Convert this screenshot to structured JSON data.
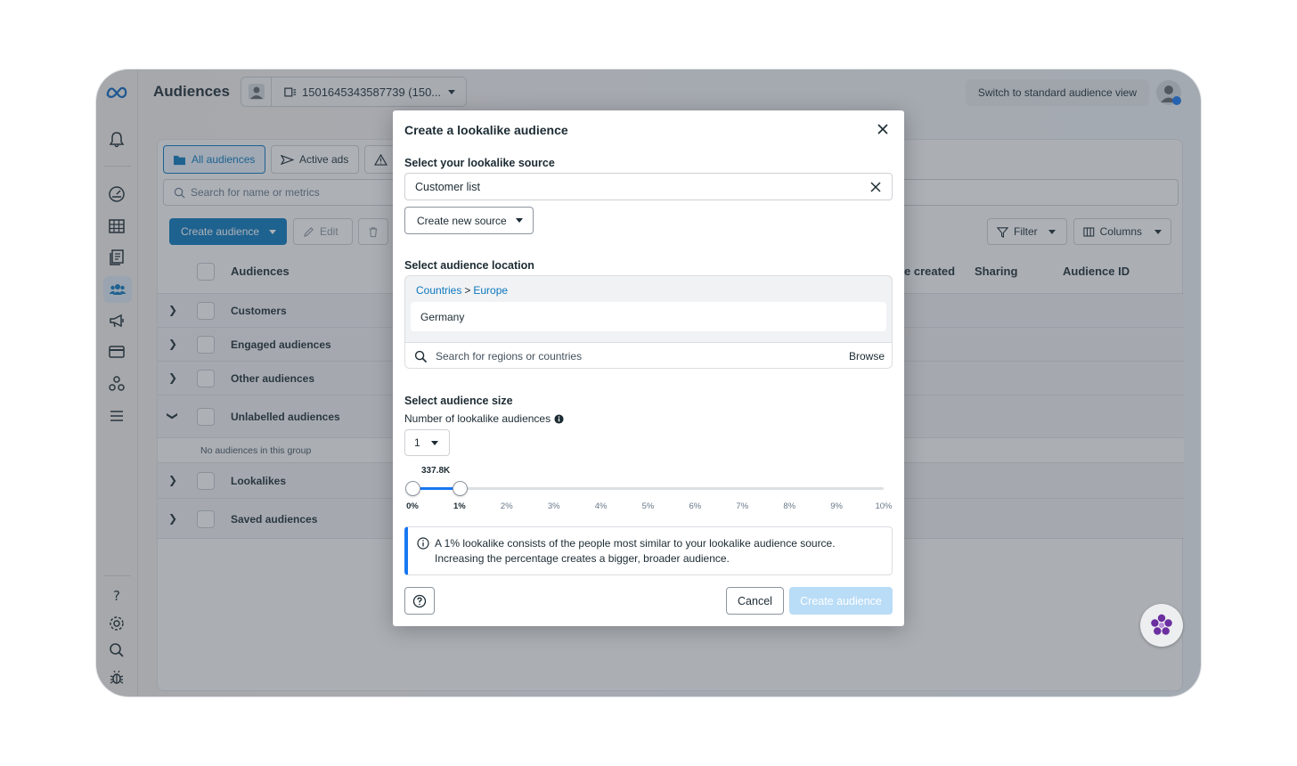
{
  "header": {
    "title": "Audiences",
    "account": "1501645343587739 (150...",
    "switch_label": "Switch to standard audience view"
  },
  "tabs": [
    {
      "label": "All audiences"
    },
    {
      "label": "Active ads"
    }
  ],
  "search": {
    "placeholder": "Search for name or metrics"
  },
  "toolbar": {
    "create_label": "Create audience",
    "edit_label": "Edit",
    "filter_label": "Filter",
    "columns_label": "Columns"
  },
  "table": {
    "columns": {
      "audiences": "Audiences",
      "date_created": "e created",
      "sharing": "Sharing",
      "audience_id": "Audience ID"
    },
    "groups": [
      {
        "label": "Customers"
      },
      {
        "label": "Engaged audiences"
      },
      {
        "label": "Other audiences"
      },
      {
        "label": "Unlabelled audiences"
      },
      {
        "label": "Lookalikes"
      },
      {
        "label": "Saved audiences"
      }
    ],
    "empty_group_text": "No audiences in this group"
  },
  "modal": {
    "title": "Create a lookalike audience",
    "source_label": "Select your lookalike source",
    "source_value": "Customer list",
    "create_source_label": "Create new source",
    "location_label": "Select audience location",
    "breadcrumb_countries": "Countries",
    "breadcrumb_sep": ">",
    "breadcrumb_region": "Europe",
    "selected_country": "Germany",
    "location_search_placeholder": "Search for regions or countries",
    "browse_label": "Browse",
    "size_label": "Select audience size",
    "number_label": "Number of lookalike audiences",
    "number_value": "1",
    "slider_value": "337.8K",
    "slider_range": {
      "start_percent": 0,
      "end_percent": 1
    },
    "ticks": [
      "0%",
      "1%",
      "2%",
      "3%",
      "4%",
      "5%",
      "6%",
      "7%",
      "8%",
      "9%",
      "10%"
    ],
    "info_line1": "A 1% lookalike consists of the people most similar to your lookalike audience source.",
    "info_line2": "Increasing the percentage creates a bigger, broader audience.",
    "cancel_label": "Cancel",
    "submit_label": "Create audience"
  },
  "colors": {
    "accent": "#0a78be",
    "slider": "#1877f2",
    "disabled_button": "#b9dcf7"
  }
}
